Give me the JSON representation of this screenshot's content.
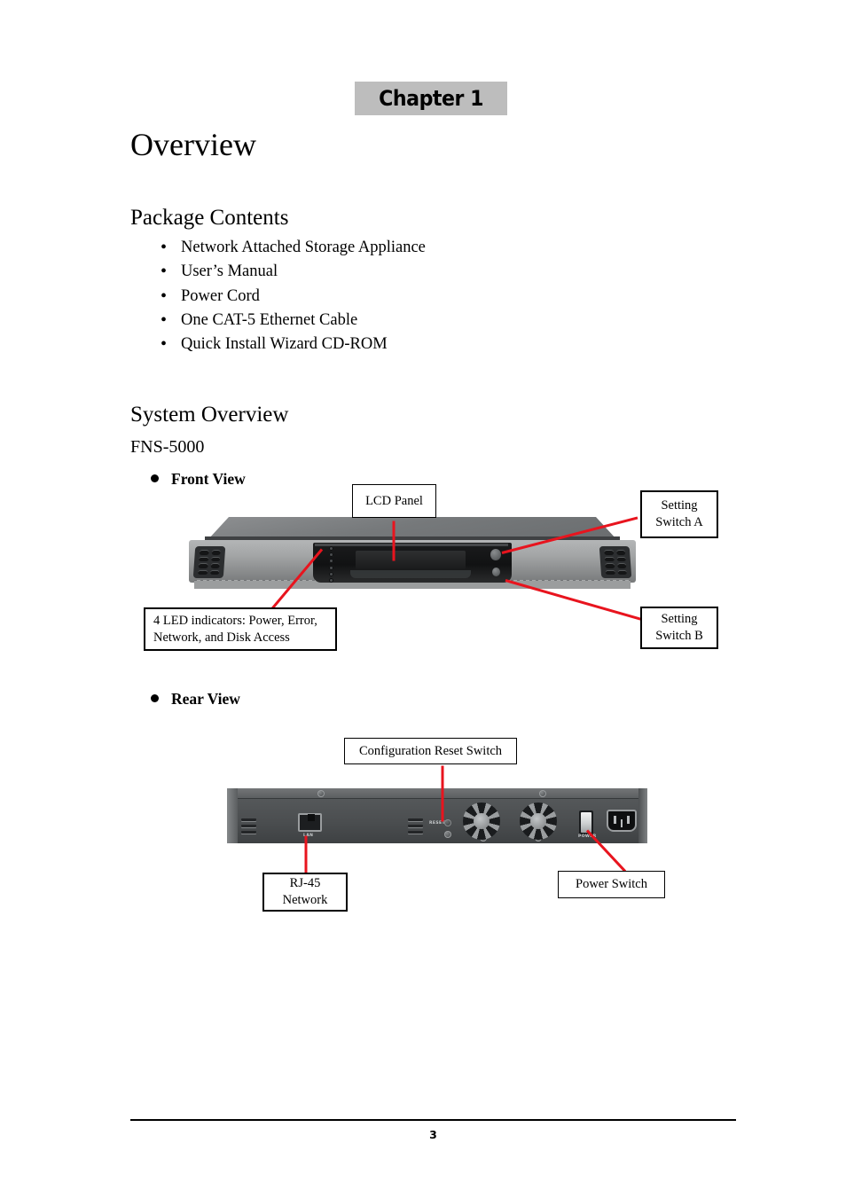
{
  "document": {
    "chapter_banner": "Chapter 1",
    "title": "Overview",
    "page_number": "3"
  },
  "package_contents": {
    "heading": "Package Contents",
    "bullet_glyph": "•",
    "items": [
      "Network Attached Storage Appliance",
      "User’s Manual",
      "Power Cord",
      "One CAT-5 Ethernet Cable",
      "Quick Install Wizard CD-ROM"
    ]
  },
  "system_overview": {
    "heading": "System Overview",
    "model": "FNS-5000",
    "front_view": {
      "label": "Front View",
      "callouts": {
        "lcd_panel": "LCD Panel",
        "setting_switch_a": "Setting\nSwitch A",
        "setting_switch_a_line1": "Setting",
        "setting_switch_a_line2": "Switch A",
        "setting_switch_b_line1": "Setting",
        "setting_switch_b_line2": "Switch B",
        "led_indicators_line1": "4 LED indicators: Power, Error,",
        "led_indicators_line2": "Network, and Disk Access"
      }
    },
    "rear_view": {
      "label": "Rear View",
      "callouts": {
        "configuration_reset_switch": "Configuration Reset Switch",
        "rj45_line1": "RJ-45",
        "rj45_line2": "Network",
        "power_switch": "Power Switch"
      },
      "port_labels": {
        "lan": "LAN",
        "reset": "RESET",
        "power": "POWER"
      }
    }
  },
  "colors": {
    "banner_background": "#bdbdbd",
    "leader_line": "#e8141e",
    "text": "#000000",
    "page_background": "#ffffff"
  }
}
